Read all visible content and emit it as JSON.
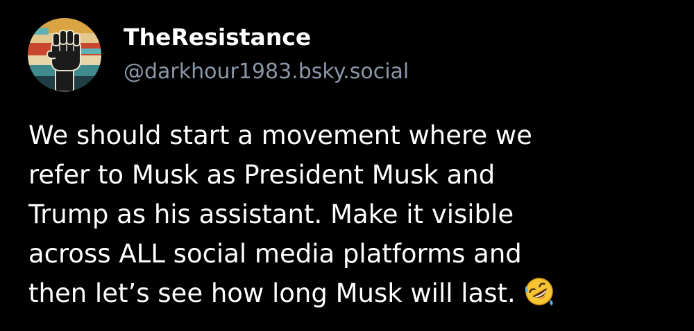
{
  "post": {
    "author": {
      "display_name": "TheResistance",
      "handle": "@darkhour1983.bsky.social",
      "avatar_icon": "raised-fist-icon"
    },
    "text_lines": [
      "We should start a movement where we",
      "refer to Musk as President Musk and",
      "Trump as his assistant. Make it visible",
      "across ALL social media platforms and",
      "then let’s see how long Musk will last."
    ],
    "emoji": "rolling-on-the-floor-laughing-icon"
  },
  "colors": {
    "background": "#000000",
    "text": "#ffffff",
    "handle": "#8b98a9"
  }
}
